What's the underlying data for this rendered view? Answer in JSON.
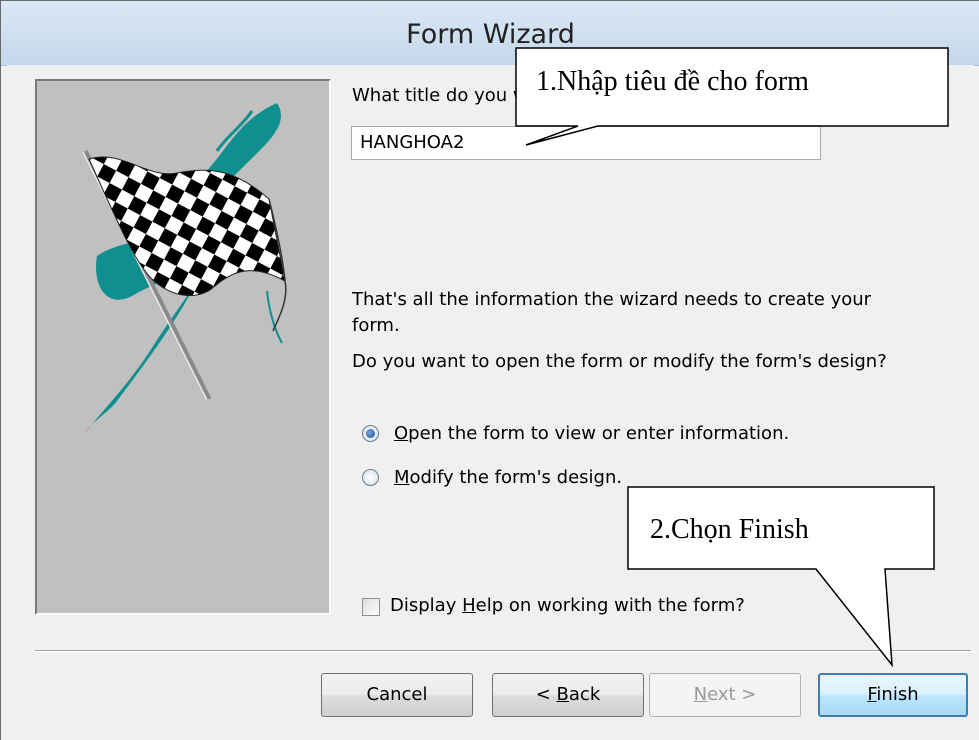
{
  "window": {
    "title": "Form Wizard"
  },
  "wizard": {
    "title_prompt": "What title do you want for your form?",
    "title_value": "HANGHOA2",
    "info_line1": "That's all the information the wizard needs to create your",
    "info_line2": "form.",
    "question": "Do you want to open the form or modify the form's design?",
    "options": [
      {
        "label": "Open the form to view or enter information.",
        "mnemonic": "O",
        "rest": "pen the form to view or enter information.",
        "selected": true
      },
      {
        "label": "Modify the form's design.",
        "mnemonic": "M",
        "rest": "odify the form's design.",
        "selected": false
      }
    ],
    "help_checkbox": {
      "label_pre": "Display ",
      "mnemonic": "H",
      "label_post": "elp on working with the form?",
      "checked": false
    }
  },
  "buttons": {
    "cancel": "Cancel",
    "back_pre": "< ",
    "back_mnemonic": "B",
    "back_post": "ack",
    "next_mnemonic": "N",
    "next_post": "ext >",
    "finish_mnemonic": "F",
    "finish_post": "inish"
  },
  "callouts": {
    "step1": "1.Nhập tiêu đề cho form",
    "step2": "2.Chọn Finish"
  },
  "colors": {
    "accent": "#0f8f8f",
    "default_button_border": "#3c7fb1",
    "panel_gray": "#c0c0c0"
  },
  "icons": [
    "checkered-flag-illustration",
    "radio-icon",
    "checkbox-icon"
  ]
}
